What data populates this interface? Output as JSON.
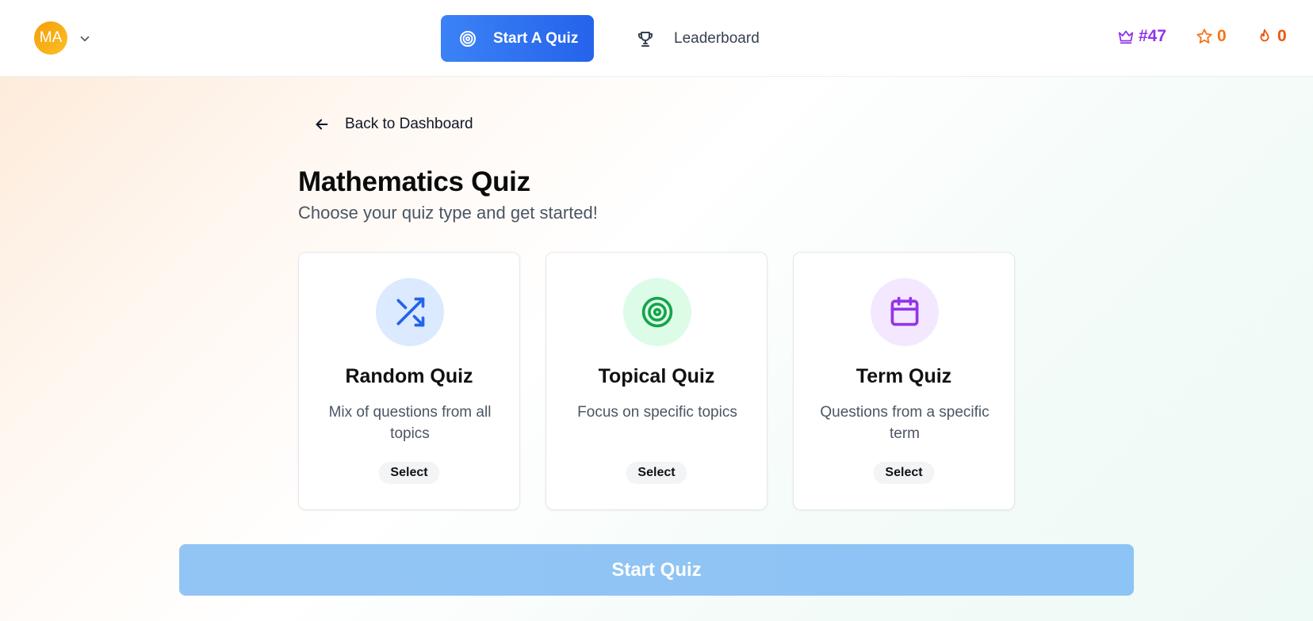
{
  "header": {
    "avatar_initials": "MA",
    "nav": {
      "start_quiz_label": "Start A Quiz",
      "leaderboard_label": "Leaderboard"
    },
    "stats": {
      "rank": "#47",
      "stars": "0",
      "streak": "0"
    }
  },
  "main": {
    "back_label": "Back to Dashboard",
    "title": "Mathematics Quiz",
    "subtitle": "Choose your quiz type and get started!",
    "cards": [
      {
        "title": "Random Quiz",
        "description": "Mix of questions from all topics",
        "select_label": "Select",
        "icon": "shuffle-icon"
      },
      {
        "title": "Topical Quiz",
        "description": "Focus on specific topics",
        "select_label": "Select",
        "icon": "target-icon"
      },
      {
        "title": "Term Quiz",
        "description": "Questions from a specific term",
        "select_label": "Select",
        "icon": "calendar-icon"
      }
    ],
    "start_button_label": "Start Quiz"
  },
  "colors": {
    "primary": "#2563eb",
    "rank": "#9333ea",
    "stars": "#f97316",
    "streak": "#ea580c",
    "random_accent": "#2563eb",
    "topical_accent": "#16a34a",
    "term_accent": "#9333ea",
    "start_button_disabled": "#8ec5f4"
  }
}
